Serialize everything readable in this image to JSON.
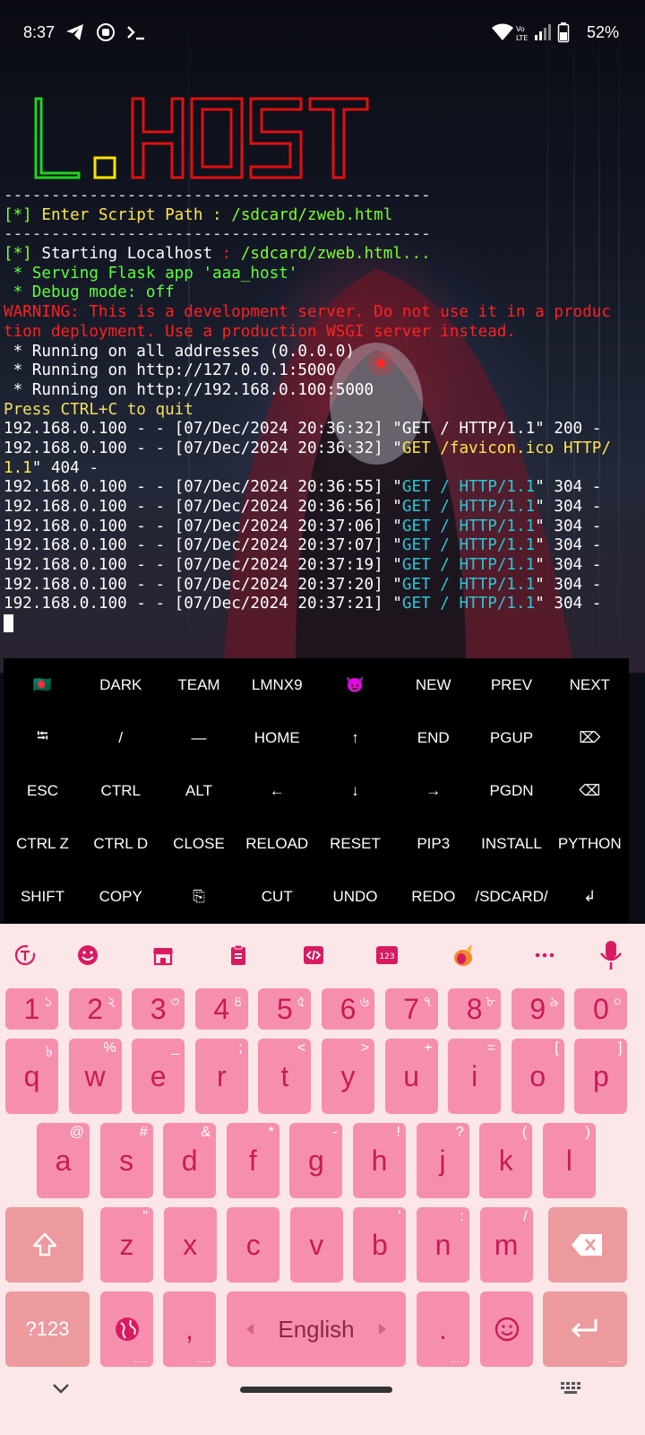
{
  "status_bar": {
    "time": "8:37",
    "left_icons": [
      "telegram-icon",
      "record-icon",
      "terminal-icon"
    ],
    "right_icons": [
      "wifi-icon",
      "volte-icon",
      "signal-icon",
      "battery-icon"
    ],
    "battery": "52%"
  },
  "banner": {
    "text": "L.HOST",
    "colors": {
      "L": "#1fd41f",
      "dot": "#ffe400",
      "HOST": "#e01010"
    }
  },
  "terminal": {
    "lines": [
      [
        {
          "t": "---------------------------------------------",
          "c": "gray"
        }
      ],
      [
        {
          "t": "[*]",
          "c": "lime"
        },
        {
          "t": " Enter Script Path ",
          "c": "yellow"
        },
        {
          "t": ": ",
          "c": "yellow"
        },
        {
          "t": "/sdcard/zweb.html",
          "c": "lime"
        }
      ],
      [
        {
          "t": "---------------------------------------------",
          "c": "gray"
        }
      ],
      [
        {
          "t": "[*]",
          "c": "lime"
        },
        {
          "t": " Starting Localhost ",
          "c": "white"
        },
        {
          "t": ": ",
          "c": "red"
        },
        {
          "t": "/sdcard/zweb.html...",
          "c": "lime"
        }
      ],
      [
        {
          "t": " * Serving Flask app 'aaa_host'",
          "c": "green"
        }
      ],
      [
        {
          "t": " * Debug mode: off",
          "c": "green"
        }
      ],
      [
        {
          "t": "WARNING: This is a development server. Do not use it in a produc",
          "c": "red"
        }
      ],
      [
        {
          "t": "tion deployment. Use a production WSGI server instead.",
          "c": "red"
        }
      ],
      [
        {
          "t": " * Running on all addresses (0.0.0.0)",
          "c": "white"
        }
      ],
      [
        {
          "t": " * Running on http://127.0.0.1:5000",
          "c": "white"
        }
      ],
      [
        {
          "t": " * Running on http://192.168.0.100:5000",
          "c": "white"
        }
      ],
      [
        {
          "t": "Press CTRL+C to quit",
          "c": "dimyel"
        }
      ],
      [
        {
          "t": "192.168.0.100 - - [07/Dec/2024 20:36:32] \"GET / HTTP/1.1\" 200 -",
          "c": "white"
        }
      ],
      [
        {
          "t": "192.168.0.100 - - [07/Dec/2024 20:36:32] \"",
          "c": "white"
        },
        {
          "t": "GET /favicon.ico HTTP/",
          "c": "yellow"
        }
      ],
      [
        {
          "t": "1.1",
          "c": "yellow"
        },
        {
          "t": "\" 404 -",
          "c": "white"
        }
      ],
      [
        {
          "t": "192.168.0.100 - - [07/Dec/2024 20:36:55] \"",
          "c": "white"
        },
        {
          "t": "GET / HTTP/1.1",
          "c": "cyan"
        },
        {
          "t": "\" 304 -",
          "c": "white"
        }
      ],
      [
        {
          "t": "192.168.0.100 - - [07/Dec/2024 20:36:56] \"",
          "c": "white"
        },
        {
          "t": "GET / HTTP/1.1",
          "c": "cyan"
        },
        {
          "t": "\" 304 -",
          "c": "white"
        }
      ],
      [
        {
          "t": "192.168.0.100 - - [07/Dec/2024 20:37:06] \"",
          "c": "white"
        },
        {
          "t": "GET / HTTP/1.1",
          "c": "cyan"
        },
        {
          "t": "\" 304 -",
          "c": "white"
        }
      ],
      [
        {
          "t": "192.168.0.100 - - [07/Dec/2024 20:37:07] \"",
          "c": "white"
        },
        {
          "t": "GET / HTTP/1.1",
          "c": "cyan"
        },
        {
          "t": "\" 304 -",
          "c": "white"
        }
      ],
      [
        {
          "t": "192.168.0.100 - - [07/Dec/2024 20:37:19] \"",
          "c": "white"
        },
        {
          "t": "GET / HTTP/1.1",
          "c": "cyan"
        },
        {
          "t": "\" 304 -",
          "c": "white"
        }
      ],
      [
        {
          "t": "192.168.0.100 - - [07/Dec/2024 20:37:20] \"",
          "c": "white"
        },
        {
          "t": "GET / HTTP/1.1",
          "c": "cyan"
        },
        {
          "t": "\" 304 -",
          "c": "white"
        }
      ],
      [
        {
          "t": "192.168.0.100 - - [07/Dec/2024 20:37:21] \"",
          "c": "white"
        },
        {
          "t": "GET / HTTP/1.1",
          "c": "cyan"
        },
        {
          "t": "\" 304 -",
          "c": "white"
        }
      ]
    ]
  },
  "extra_keys": [
    [
      "🇧🇩",
      "DARK",
      "TEAM",
      "LMNX9",
      "😈",
      "NEW",
      "PREV",
      "NEXT"
    ],
    [
      "⭾",
      "/",
      "—",
      "HOME",
      "↑",
      "END",
      "PGUP",
      "⌦"
    ],
    [
      "ESC",
      "CTRL",
      "ALT",
      "←",
      "↓",
      "→",
      "PGDN",
      "⌫"
    ],
    [
      "CTRL Z",
      "CTRL D",
      "CLOSE",
      "RELOAD",
      "RESET",
      "PIP3",
      "INSTALL",
      "PYTHON"
    ],
    [
      "SHIFT",
      "COPY",
      "⎘",
      "CUT",
      "UNDO",
      "REDO",
      "/SDCARD/",
      "↲"
    ]
  ],
  "keyboard": {
    "toolbar": [
      "text-tool-icon",
      "emoji-icon",
      "store-icon",
      "clipboard-icon",
      "code-icon",
      "numpad-icon",
      "sticker-icon",
      "more-icon",
      "mic-icon"
    ],
    "number_row": [
      {
        "k": "1",
        "h": "১"
      },
      {
        "k": "2",
        "h": "২"
      },
      {
        "k": "3",
        "h": "৩"
      },
      {
        "k": "4",
        "h": "৪"
      },
      {
        "k": "5",
        "h": "৫"
      },
      {
        "k": "6",
        "h": "৬"
      },
      {
        "k": "7",
        "h": "৭"
      },
      {
        "k": "8",
        "h": "৮"
      },
      {
        "k": "9",
        "h": "৯"
      },
      {
        "k": "0",
        "h": "০"
      }
    ],
    "row1": [
      {
        "k": "q",
        "h": "৳"
      },
      {
        "k": "w",
        "h": "%"
      },
      {
        "k": "e",
        "h": "_"
      },
      {
        "k": "r",
        "h": ";"
      },
      {
        "k": "t",
        "h": "<"
      },
      {
        "k": "y",
        "h": ">"
      },
      {
        "k": "u",
        "h": "+"
      },
      {
        "k": "i",
        "h": "="
      },
      {
        "k": "o",
        "h": "["
      },
      {
        "k": "p",
        "h": "]"
      }
    ],
    "row2": [
      {
        "k": "a",
        "h": "@"
      },
      {
        "k": "s",
        "h": "#"
      },
      {
        "k": "d",
        "h": "&"
      },
      {
        "k": "f",
        "h": "*"
      },
      {
        "k": "g",
        "h": "-"
      },
      {
        "k": "h",
        "h": "!"
      },
      {
        "k": "j",
        "h": "?"
      },
      {
        "k": "k",
        "h": "("
      },
      {
        "k": "l",
        "h": ")"
      }
    ],
    "row3": [
      {
        "k": "z",
        "h": "\""
      },
      {
        "k": "x",
        "h": ""
      },
      {
        "k": "c",
        "h": ""
      },
      {
        "k": "v",
        "h": ""
      },
      {
        "k": "b",
        "h": "'"
      },
      {
        "k": "n",
        "h": ":"
      },
      {
        "k": "m",
        "h": "/"
      }
    ],
    "symbols_label": "?123",
    "comma": ",",
    "space_label": "English",
    "period": ".",
    "colors": {
      "key": "#f68fae",
      "fn_key": "#ec9a9d",
      "key_text": "#c71c55",
      "background": "#fbe6e8"
    }
  }
}
